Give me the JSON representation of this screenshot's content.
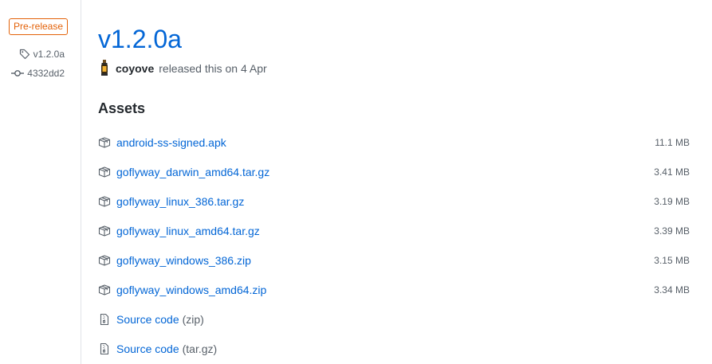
{
  "sidebar": {
    "badge": "Pre-release",
    "tag": "v1.2.0a",
    "commit": "4332dd2"
  },
  "release": {
    "title": "v1.2.0a",
    "author": "coyove",
    "released_text": "released this on 4 Apr"
  },
  "assets": {
    "heading": "Assets",
    "files": [
      {
        "name": "android-ss-signed.apk",
        "size": "11.1 MB"
      },
      {
        "name": "goflyway_darwin_amd64.tar.gz",
        "size": "3.41 MB"
      },
      {
        "name": "goflyway_linux_386.tar.gz",
        "size": "3.19 MB"
      },
      {
        "name": "goflyway_linux_amd64.tar.gz",
        "size": "3.39 MB"
      },
      {
        "name": "goflyway_windows_386.zip",
        "size": "3.15 MB"
      },
      {
        "name": "goflyway_windows_amd64.zip",
        "size": "3.34 MB"
      }
    ],
    "source": [
      {
        "name": "Source code",
        "kind": "(zip)"
      },
      {
        "name": "Source code",
        "kind": "(tar.gz)"
      }
    ]
  },
  "colors": {
    "link": "#0366d6",
    "prerelease": "#e36209",
    "muted": "#586069",
    "text": "#24292e",
    "border": "#e1e4e8"
  },
  "icons": {
    "badge": "none",
    "tag": "tag-icon",
    "commit": "git-commit-icon",
    "asset": "package-icon",
    "source": "file-zip-icon",
    "avatar": "avatar-lantern"
  }
}
